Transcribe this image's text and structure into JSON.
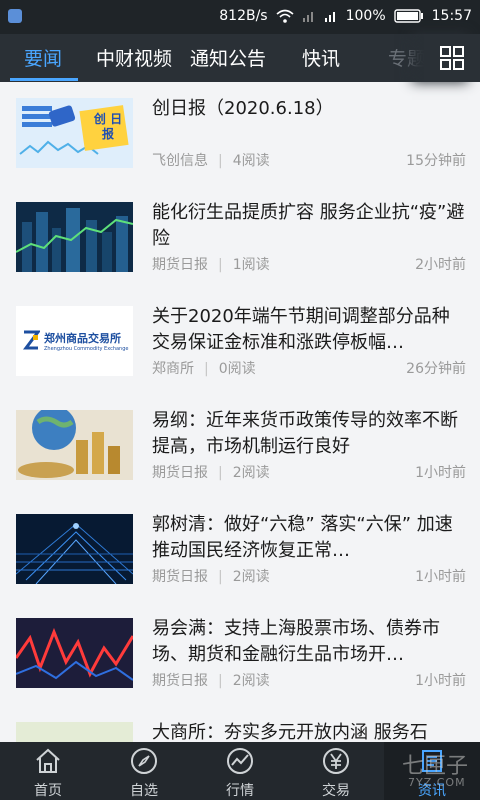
{
  "status_bar": {
    "network_speed": "812B/s",
    "battery": "100%",
    "time": "15:57"
  },
  "tabs": [
    {
      "label": "要闻",
      "active": true
    },
    {
      "label": "中财视频",
      "active": false
    },
    {
      "label": "通知公告",
      "active": false
    },
    {
      "label": "快讯",
      "active": false
    },
    {
      "label": "专题",
      "active": false
    }
  ],
  "articles": [
    {
      "title": "创日报（2020.6.18）",
      "source": "飞创信息",
      "reads": "4阅读",
      "time": "15分钟前",
      "thumb": "chuang-ribao-banner",
      "thumb_text": "创 日报"
    },
    {
      "title": "能化衍生品提质扩容 服务企业抗“疫”避险",
      "source": "期货日报",
      "reads": "1阅读",
      "time": "2小时前",
      "thumb": "city-chart-image"
    },
    {
      "title": "关于2020年端午节期间调整部分品种交易保证金标准和涨跌停板幅…",
      "source": "郑商所",
      "reads": "0阅读",
      "time": "26分钟前",
      "thumb": "zce-logo",
      "thumb_text": "郑州商品交易所",
      "thumb_subtext": "Zhengzhou Commodity Exchange"
    },
    {
      "title": "易纲：近年来货币政策传导的效率不断提高，市场机制运行良好",
      "source": "期货日报",
      "reads": "2阅读",
      "time": "1小时前",
      "thumb": "coins-globe-image"
    },
    {
      "title": "郭树清：做好“六稳” 落实“六保” 加速推动国民经济恢复正常…",
      "source": "期货日报",
      "reads": "2阅读",
      "time": "1小时前",
      "thumb": "data-stream-image"
    },
    {
      "title": "易会满：支持上海股票市场、债券市场、期货和金融衍生品市场开…",
      "source": "期货日报",
      "reads": "2阅读",
      "time": "1小时前",
      "thumb": "red-chart-image"
    },
    {
      "title": "大商所：夯实多元开放内涵 服务石",
      "source": "",
      "reads": "",
      "time": "",
      "thumb": "partial-image"
    }
  ],
  "bottom_nav": [
    {
      "label": "首页",
      "icon": "home-icon",
      "active": false
    },
    {
      "label": "自选",
      "icon": "compass-icon",
      "active": false
    },
    {
      "label": "行情",
      "icon": "trend-icon",
      "active": false
    },
    {
      "label": "交易",
      "icon": "yen-icon",
      "active": false
    },
    {
      "label": "资讯",
      "icon": "news-icon",
      "active": true
    }
  ],
  "watermark": {
    "line1": "七匣子",
    "line2": "7YZ.COM"
  },
  "colors": {
    "accent": "#4aa6ff",
    "tab_bg": "#2a3036",
    "list_bg": "#f3f4f6",
    "bottom_bg": "#23282d"
  }
}
